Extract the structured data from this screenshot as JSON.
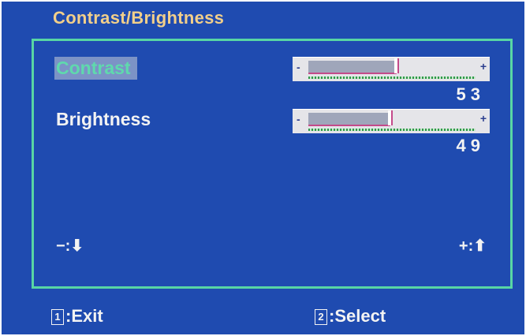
{
  "menu": {
    "title": "Contrast/Brightness",
    "items": [
      {
        "label": "Contrast",
        "value": "53",
        "level": 0.53,
        "selected": true
      },
      {
        "label": "Brightness",
        "value": "49",
        "level": 0.49,
        "selected": false
      }
    ],
    "slider": {
      "minus": "-",
      "plus": "+"
    },
    "nav": {
      "decrease": "−:⬇",
      "increase": "+:⬆"
    },
    "footer": {
      "exit_key": "1",
      "exit_label": ":Exit",
      "select_key": "2",
      "select_label": ":Select"
    }
  },
  "colors": {
    "background": "#1f4bb0",
    "title": "#f2cf8a",
    "frame": "#58d6a4",
    "selected_text": "#5fd9ad",
    "text": "#f3f3f3"
  }
}
